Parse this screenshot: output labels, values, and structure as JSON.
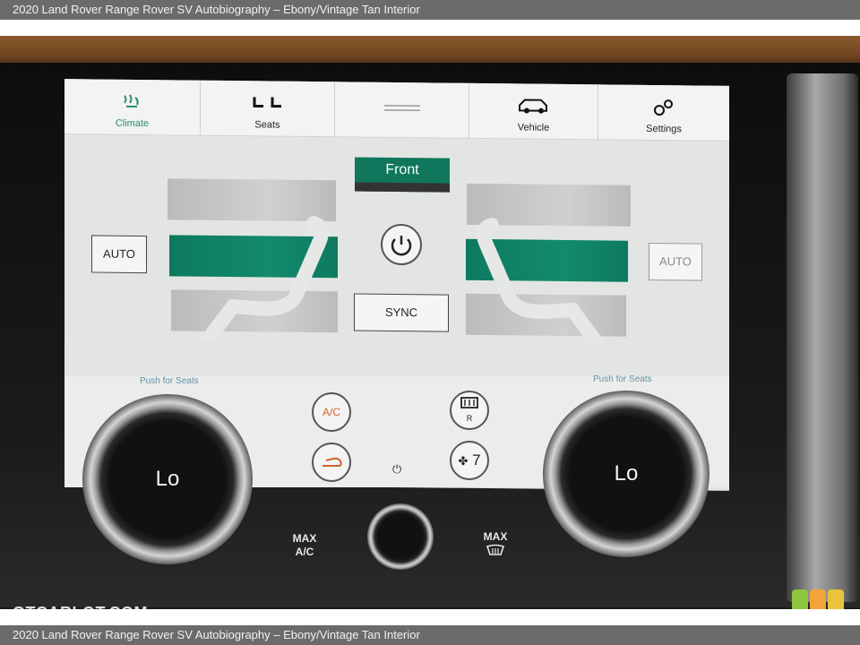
{
  "caption": {
    "top": "2020 Land Rover Range Rover SV Autobiography – Ebony/Vintage Tan Interior",
    "bottom": "2020 Land Rover Range Rover SV Autobiography – Ebony/Vintage Tan Interior"
  },
  "tabs": [
    {
      "label": "Climate",
      "icon": "climate-icon"
    },
    {
      "label": "Seats",
      "icon": "seats-icon"
    },
    {
      "label": "",
      "icon": "handle-icon"
    },
    {
      "label": "Vehicle",
      "icon": "vehicle-icon"
    },
    {
      "label": "Settings",
      "icon": "settings-icon"
    }
  ],
  "climate": {
    "front_label": "Front",
    "left_auto": "AUTO",
    "right_auto": "AUTO",
    "sync": "SYNC",
    "ac": "A/C",
    "rear_defrost_sub": "R",
    "fan_speed": "7",
    "push_left": "Push for Seats",
    "push_right": "Push for Seats"
  },
  "knobs": {
    "left_value": "Lo",
    "right_value": "Lo",
    "max_ac": [
      "MAX",
      "A/C"
    ],
    "max_defrost": "MAX"
  },
  "watermark": "GTCARLOT.COM",
  "colors": {
    "accent_green": "#10775c",
    "ac_orange": "#d2622a"
  }
}
